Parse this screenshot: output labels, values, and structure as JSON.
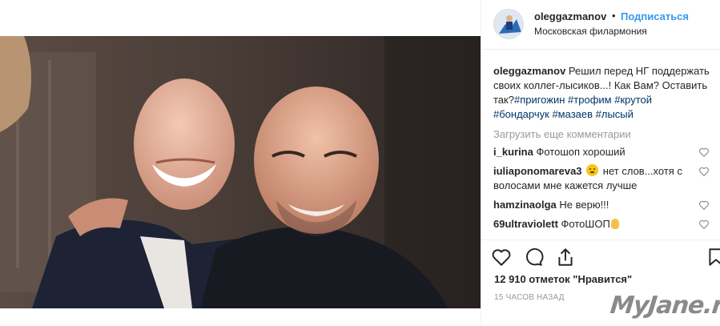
{
  "post": {
    "username": "oleggazmanov",
    "follow_label": "Подписаться",
    "dot": "•",
    "location": "Московская филармония",
    "caption": {
      "username": "oleggazmanov",
      "text": "Решил перед НГ поддержать своих коллег-лысиков...! Как Вам? Оставить так?",
      "hashtags": [
        "#пригожин",
        "#трофим",
        "#крутой",
        "#бондарчук",
        "#мазаев",
        "#лысый"
      ]
    },
    "load_more_label": "Загрузить еще комментарии",
    "comments": [
      {
        "username": "i_kurina",
        "text": "Фотошоп хороший"
      },
      {
        "username": "iuliaponomareva3",
        "text_before": "",
        "text": "нет слов...хотя с волосами мне кажется лучше"
      },
      {
        "username": "hamzinaolga",
        "text": "Не верю!!!"
      },
      {
        "username": "69ultraviolett",
        "text": "ФотоШОП"
      }
    ],
    "likes_text": "12 910 отметок \"Нравится\"",
    "time_text": "15 часов назад"
  },
  "icons": {
    "like": "heart-icon",
    "comment": "comment-icon",
    "share": "share-icon",
    "save": "bookmark-icon",
    "tag": "person-tag-icon"
  },
  "colors": {
    "link": "#3897f0",
    "hashtag": "#003569",
    "muted": "#999999",
    "text": "#262626"
  },
  "watermark": "MyJane.ru"
}
